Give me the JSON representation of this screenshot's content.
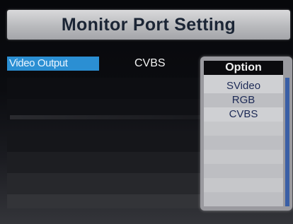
{
  "title": "Monitor Port Setting",
  "setting": {
    "label": "Video Output",
    "value": "CVBS"
  },
  "popup": {
    "header": "Option",
    "options": [
      "SVideo",
      "RGB",
      "CVBS"
    ]
  },
  "colors": {
    "highlight": "#2b8fd3",
    "title_bar": "#c4c5c8",
    "popup_bg": "#cfd0d3",
    "scrollbar": "#3a5fa6"
  }
}
